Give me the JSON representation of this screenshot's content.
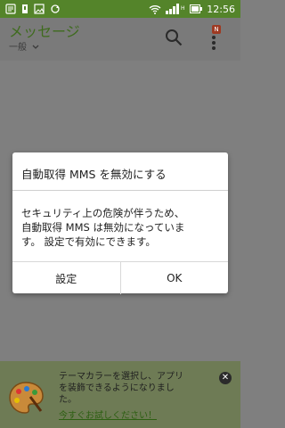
{
  "status_bar": {
    "time": "12:56",
    "icons": [
      "notification-icon",
      "sim-icon",
      "image-icon",
      "sync-icon",
      "wifi-icon",
      "signal-icon",
      "battery-icon"
    ],
    "color": "#54842a"
  },
  "header": {
    "title": "メッセージ",
    "subtitle": "一般",
    "badge": "N",
    "icons": [
      "search-icon",
      "more-menu-icon"
    ]
  },
  "dialog": {
    "title": "自動取得 MMS を無効にする",
    "body_lines": [
      "セキュリティ上の危険が伴うため、",
      "自動取得 MMS は無効になっていま",
      "す。 設定で有効にできます。"
    ],
    "buttons": {
      "settings": "設定",
      "ok": "OK"
    }
  },
  "banner": {
    "text_lines": [
      "テーマカラーを選択し、アプリ",
      "を装飾できるようになりまし",
      "た。"
    ],
    "link": "今すぐお試しください！",
    "icon": "palette-icon",
    "close_icon": "close-icon"
  },
  "colors": {
    "accent_green": "#54842a",
    "scrim": "#7f7f7f",
    "dialog_bg": "#ffffff"
  }
}
